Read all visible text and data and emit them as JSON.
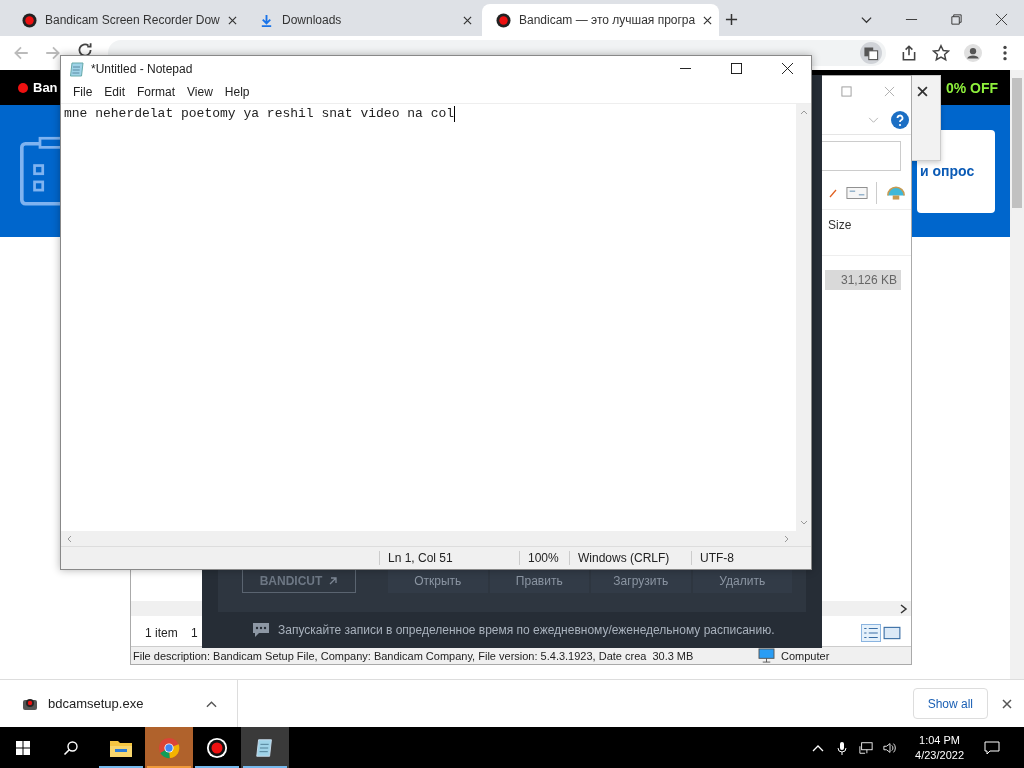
{
  "browser": {
    "tabs": [
      {
        "title": "Bandicam Screen Recorder Dow",
        "kind": "record",
        "selected": false
      },
      {
        "title": "Downloads",
        "kind": "download",
        "selected": false
      },
      {
        "title": "Bandicam — это лучшая програ",
        "kind": "record",
        "selected": true
      }
    ],
    "promo_left": "Ban",
    "promo_right": "0% OFF",
    "banner_text": "и опрос"
  },
  "explorer": {
    "column": "Size",
    "file": {
      "size": "31,126 KB",
      "selected": true
    },
    "item_count": "1 item",
    "selection_count": "1",
    "status_description": "File description: Bandicam Setup File, Company: Bandicam Company, File version: 5.4.3.1923, Date crea",
    "status_size": "30.3 MB",
    "status_location": "Computer"
  },
  "bandicam": {
    "logo": "BANDICUT",
    "buttons": [
      "Открыть",
      "Править",
      "Загрузить",
      "Удалить"
    ],
    "tip": "Запускайте записи в определенное время по ежедневному/еженедельному расписанию."
  },
  "notepad": {
    "title": "*Untitled - Notepad",
    "menu": [
      "File",
      "Edit",
      "Format",
      "View",
      "Help"
    ],
    "text": "mne neherdelat poetomy ya reshil snat video na col",
    "status": [
      "Ln 1, Col 51",
      "100%",
      "Windows (CRLF)",
      "UTF-8"
    ]
  },
  "downloads": {
    "file": "bdcamsetup.exe",
    "show_all": "Show all"
  },
  "taskbar": {
    "apps": [
      {
        "kind": "folder",
        "active": false,
        "attention": false
      },
      {
        "kind": "chrome",
        "active": false,
        "attention": true
      },
      {
        "kind": "record",
        "active": false,
        "attention": false
      },
      {
        "kind": "notepad",
        "active": true,
        "attention": false
      }
    ],
    "time": "1:04 PM",
    "date": "4/23/2022"
  }
}
